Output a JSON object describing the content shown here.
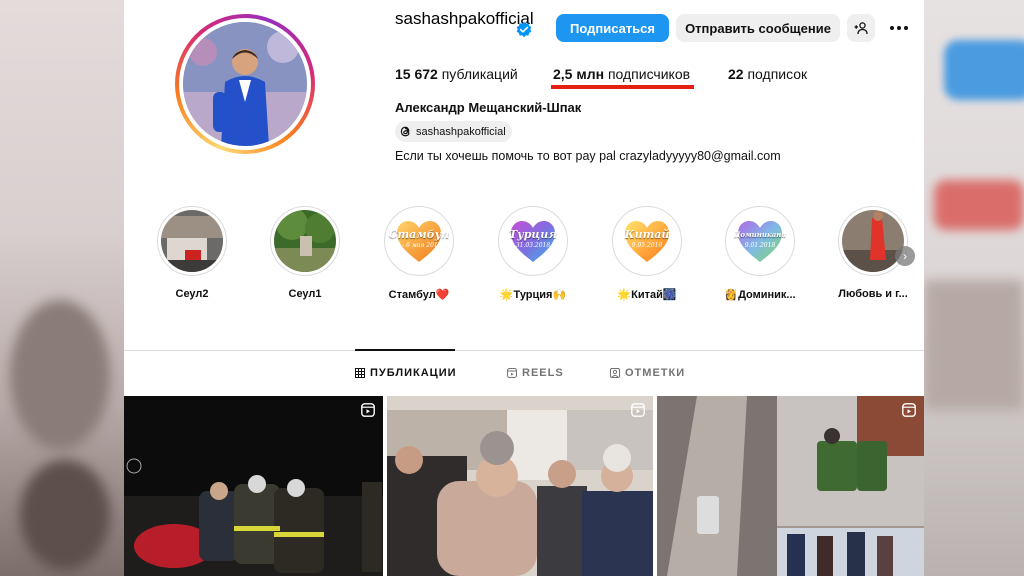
{
  "profile": {
    "username": "sashashpakofficial",
    "verified": true,
    "full_name": "Александр Мещанский-Шпак",
    "threads_handle": "sashashpakofficial",
    "bio": "Если ты хочешь помочь то вот pay pal crazyladyyyyy80@gmail.com"
  },
  "actions": {
    "follow_label": "Подписаться",
    "message_label": "Отправить сообщение",
    "suggest_icon": "add-person-icon",
    "more_icon": "more-options-icon"
  },
  "stats": {
    "posts_value": "15 672",
    "posts_label": "публикаций",
    "followers_value": "2,5 млн",
    "followers_label": "подписчиков",
    "following_value": "22",
    "following_label": "подписок"
  },
  "highlights": [
    {
      "label": "Сеул2"
    },
    {
      "label": "Сеул1"
    },
    {
      "label": "Стамбул❤️",
      "heart_title": "Стамбул",
      "heart_sub": "2 - 6 мая 2018"
    },
    {
      "label": "🌟Турция🙌",
      "heart_title": "Турция",
      "heart_sub": "31.03.2018"
    },
    {
      "label": "🌟Китай🎆",
      "heart_title": "Китай",
      "heart_sub": "9.05.2018"
    },
    {
      "label": "👸Доминик...",
      "heart_title": "Доминикана",
      "heart_sub": "9.01.2018"
    },
    {
      "label": "Любовь и г..."
    }
  ],
  "tabs": [
    {
      "label": "ПУБЛИКАЦИИ",
      "icon": "grid-icon",
      "active": true
    },
    {
      "label": "REELS",
      "icon": "reels-icon",
      "active": false
    },
    {
      "label": "ОТМЕТКИ",
      "icon": "tagged-icon",
      "active": false
    }
  ],
  "colors": {
    "follow_button": "#1c96f0",
    "annotation_underline": "#e32012",
    "verified_badge": "#0095f6"
  }
}
